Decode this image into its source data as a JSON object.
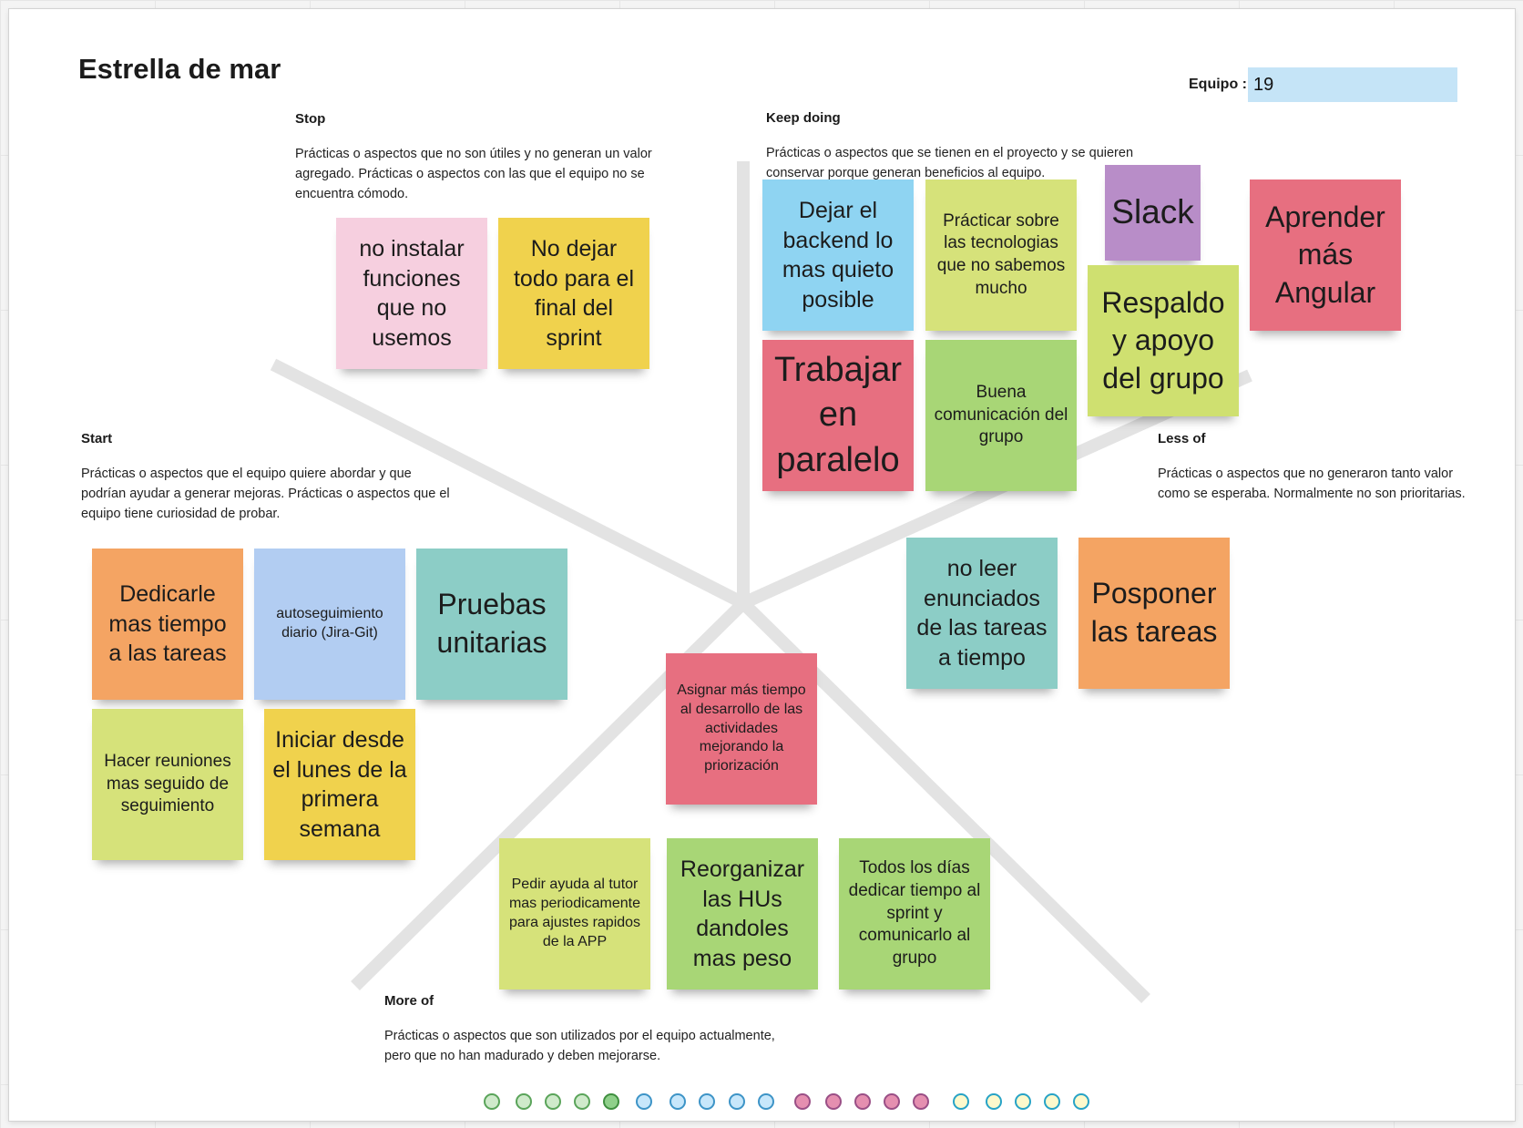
{
  "board": {
    "title": "Estrella de mar",
    "team_label": "Equipo :",
    "team_value": "19"
  },
  "sections": {
    "stop": {
      "title": "Stop",
      "description": "Prácticas o aspectos que no son útiles y no generan un valor agregado. Prácticas o aspectos con las que el equipo no se encuentra cómodo."
    },
    "keep": {
      "title": "Keep doing",
      "description": "Prácticas o aspectos que se tienen en el proyecto y se quieren conservar porque generan beneficios al equipo."
    },
    "start": {
      "title": "Start",
      "description": "Prácticas o aspectos que el equipo quiere abordar y que podrían ayudar a generar mejoras. Prácticas o aspectos que el equipo tiene curiosidad de probar."
    },
    "less": {
      "title": "Less of",
      "description": "Prácticas o aspectos que no generaron tanto valor como se esperaba. Normalmente no son prioritarias."
    },
    "more": {
      "title": "More of",
      "description": "Prácticas o aspectos que son utilizados por el equipo actualmente, pero que no han madurado y deben mejorarse."
    }
  },
  "notes": {
    "stop_1": {
      "text": "no instalar funciones que no usemos",
      "color": "#f6cfdf"
    },
    "stop_2": {
      "text": "No dejar todo para el final del sprint",
      "color": "#f0d24d"
    },
    "keep_1": {
      "text": "Dejar el backend lo mas quieto posible",
      "color": "#8fd4f2"
    },
    "keep_2": {
      "text": "Prácticar sobre las tecnologias que no sabemos mucho",
      "color": "#d6e27a"
    },
    "keep_3": {
      "text": "Slack",
      "color": "#b88dc8"
    },
    "keep_4": {
      "text": "Aprender más Angular",
      "color": "#e76f80"
    },
    "keep_5": {
      "text": "Respaldo y apoyo del grupo",
      "color": "#cfe070"
    },
    "keep_6": {
      "text": "Trabajar en paralelo",
      "color": "#e76f80"
    },
    "keep_7": {
      "text": "Buena comunicación del grupo",
      "color": "#a8d676"
    },
    "start_1": {
      "text": "Dedicarle mas tiempo a las tareas",
      "color": "#f4a463"
    },
    "start_2": {
      "text": "autoseguimiento diario (Jira-Git)",
      "color": "#b2cdf2"
    },
    "start_3": {
      "text": "Pruebas unitarias",
      "color": "#8ccdc6"
    },
    "start_4": {
      "text": "Hacer reuniones mas seguido de seguimiento",
      "color": "#d6e27a"
    },
    "start_5": {
      "text": "Iniciar desde el lunes de la primera semana",
      "color": "#f0d24d"
    },
    "less_1": {
      "text": "no leer enunciados de las tareas a tiempo",
      "color": "#8ccdc6"
    },
    "less_2": {
      "text": "Posponer las tareas",
      "color": "#f4a463"
    },
    "center_1": {
      "text": "Asignar más tiempo al desarrollo de las actividades mejorando la priorización",
      "color": "#e76f80"
    },
    "more_1": {
      "text": "Pedir ayuda al tutor mas periodicamente para ajustes rapidos de la APP",
      "color": "#d6e27a"
    },
    "more_2": {
      "text": "Reorganizar las HUs dandoles mas peso",
      "color": "#a8d676"
    },
    "more_3": {
      "text": "Todos los días dedicar tiempo al sprint y comunicarlo al grupo",
      "color": "#a8d676"
    }
  },
  "vote_dots": [
    {
      "color": "#cfeacb",
      "border": "#5aa45a"
    },
    {
      "color": "#cfeacb",
      "border": "#5aa45a"
    },
    {
      "color": "#cfeacb",
      "border": "#5aa45a"
    },
    {
      "color": "#cfeacb",
      "border": "#5aa45a"
    },
    {
      "color": "#8fd08a",
      "border": "#3f8f3f"
    },
    {
      "color": "#c7e7fb",
      "border": "#3d94c7"
    },
    {
      "color": "#c7e7fb",
      "border": "#3d94c7"
    },
    {
      "color": "#c7e7fb",
      "border": "#3d94c7"
    },
    {
      "color": "#c7e7fb",
      "border": "#3d94c7"
    },
    {
      "color": "#c7e7fb",
      "border": "#3d94c7"
    },
    {
      "color": "#e58fb0",
      "border": "#9a4f86"
    },
    {
      "color": "#e58fb0",
      "border": "#9a4f86"
    },
    {
      "color": "#e58fb0",
      "border": "#9a4f86"
    },
    {
      "color": "#e58fb0",
      "border": "#9a4f86"
    },
    {
      "color": "#e58fb0",
      "border": "#9a4f86"
    },
    {
      "color": "#fdf9cc",
      "border": "#27a3c6"
    },
    {
      "color": "#fdf9cc",
      "border": "#27a3c6"
    },
    {
      "color": "#fdf9cc",
      "border": "#27a3c6"
    },
    {
      "color": "#fdf9cc",
      "border": "#27a3c6"
    },
    {
      "color": "#fdf9cc",
      "border": "#27a3c6"
    }
  ]
}
